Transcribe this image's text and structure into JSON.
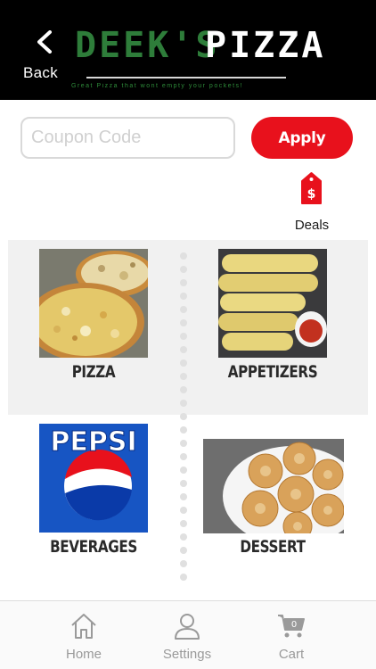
{
  "header": {
    "back_label": "Back",
    "brand_part1": "DEEK'S",
    "brand_part2": "PIZZA",
    "tagline": "Great Pizza that wont empty your pockets!"
  },
  "coupon": {
    "placeholder": "Coupon Code",
    "value": "",
    "apply_label": "Apply"
  },
  "deals": {
    "label": "Deals",
    "icon": "dollar-price-tag-icon"
  },
  "categories": [
    {
      "label": "PIZZA",
      "image": "pizza-photo"
    },
    {
      "label": "APPETIZERS",
      "image": "breadsticks-photo"
    },
    {
      "label": "BEVERAGES",
      "image": "pepsi-photo"
    },
    {
      "label": "DESSERT",
      "image": "donuts-photo"
    }
  ],
  "tabs": [
    {
      "label": "Home",
      "icon": "home-icon"
    },
    {
      "label": "Settings",
      "icon": "user-icon"
    },
    {
      "label": "Cart",
      "icon": "cart-icon",
      "badge": "0"
    }
  ],
  "colors": {
    "header_bg": "#000000",
    "brand_green": "#2e7d3a",
    "apply_red": "#e8111c",
    "tab_grey": "#9a9a9a"
  }
}
